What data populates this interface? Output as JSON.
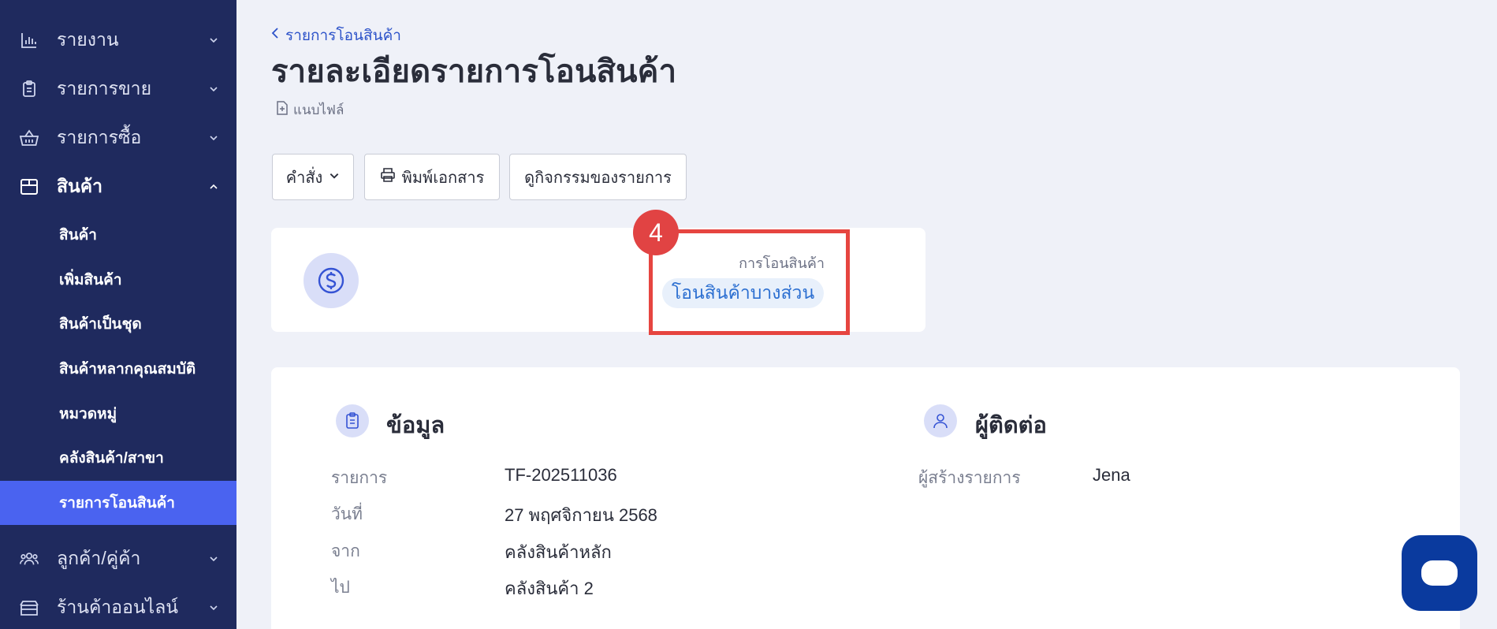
{
  "sidebar": {
    "items": [
      {
        "label": "รายงาน",
        "icon": "bar-chart-icon"
      },
      {
        "label": "รายการขาย",
        "icon": "clipboard-icon"
      },
      {
        "label": "รายการซื้อ",
        "icon": "basket-icon"
      },
      {
        "label": "สินค้า",
        "icon": "box-icon",
        "expanded": true
      },
      {
        "label": "ลูกค้า/คู่ค้า",
        "icon": "people-icon"
      },
      {
        "label": "ร้านค้าออนไลน์",
        "icon": "store-icon"
      }
    ],
    "sub_items": [
      "สินค้า",
      "เพิ่มสินค้า",
      "สินค้าเป็นชุด",
      "สินค้าหลากคุณสมบัติ",
      "หมวดหมู่",
      "คลังสินค้า/สาขา",
      "รายการโอนสินค้า"
    ],
    "selected_sub_item": "รายการโอนสินค้า"
  },
  "header": {
    "breadcrumb": "รายการโอนสินค้า",
    "title": "รายละเอียดรายการโอนสินค้า",
    "attach_label": "แนบไฟล์"
  },
  "toolbar": {
    "command_label": "คำสั่ง",
    "print_label": "พิมพ์เอกสาร",
    "activity_label": "ดูกิจกรรมของรายการ"
  },
  "status": {
    "step_number": "4",
    "label": "การโอนสินค้า",
    "value": "โอนสินค้าบางส่วน"
  },
  "info": {
    "title": "ข้อมูล",
    "rows": [
      {
        "label": "รายการ",
        "value": "TF-202511036"
      },
      {
        "label": "วันที่",
        "value": "27 พฤศจิกายน 2568"
      },
      {
        "label": "จาก",
        "value": "คลังสินค้าหลัก"
      },
      {
        "label": "ไป",
        "value": "คลังสินค้า 2"
      }
    ]
  },
  "contact": {
    "title": "ผู้ติดต่อ",
    "rows": [
      {
        "label": "ผู้สร้างรายการ",
        "value": "Jena"
      }
    ]
  },
  "colors": {
    "sidebar_bg": "#1f2a5e",
    "selected_bg": "#4a63f0",
    "highlight": "#e64540",
    "chat_bg": "#0a3a9e"
  }
}
